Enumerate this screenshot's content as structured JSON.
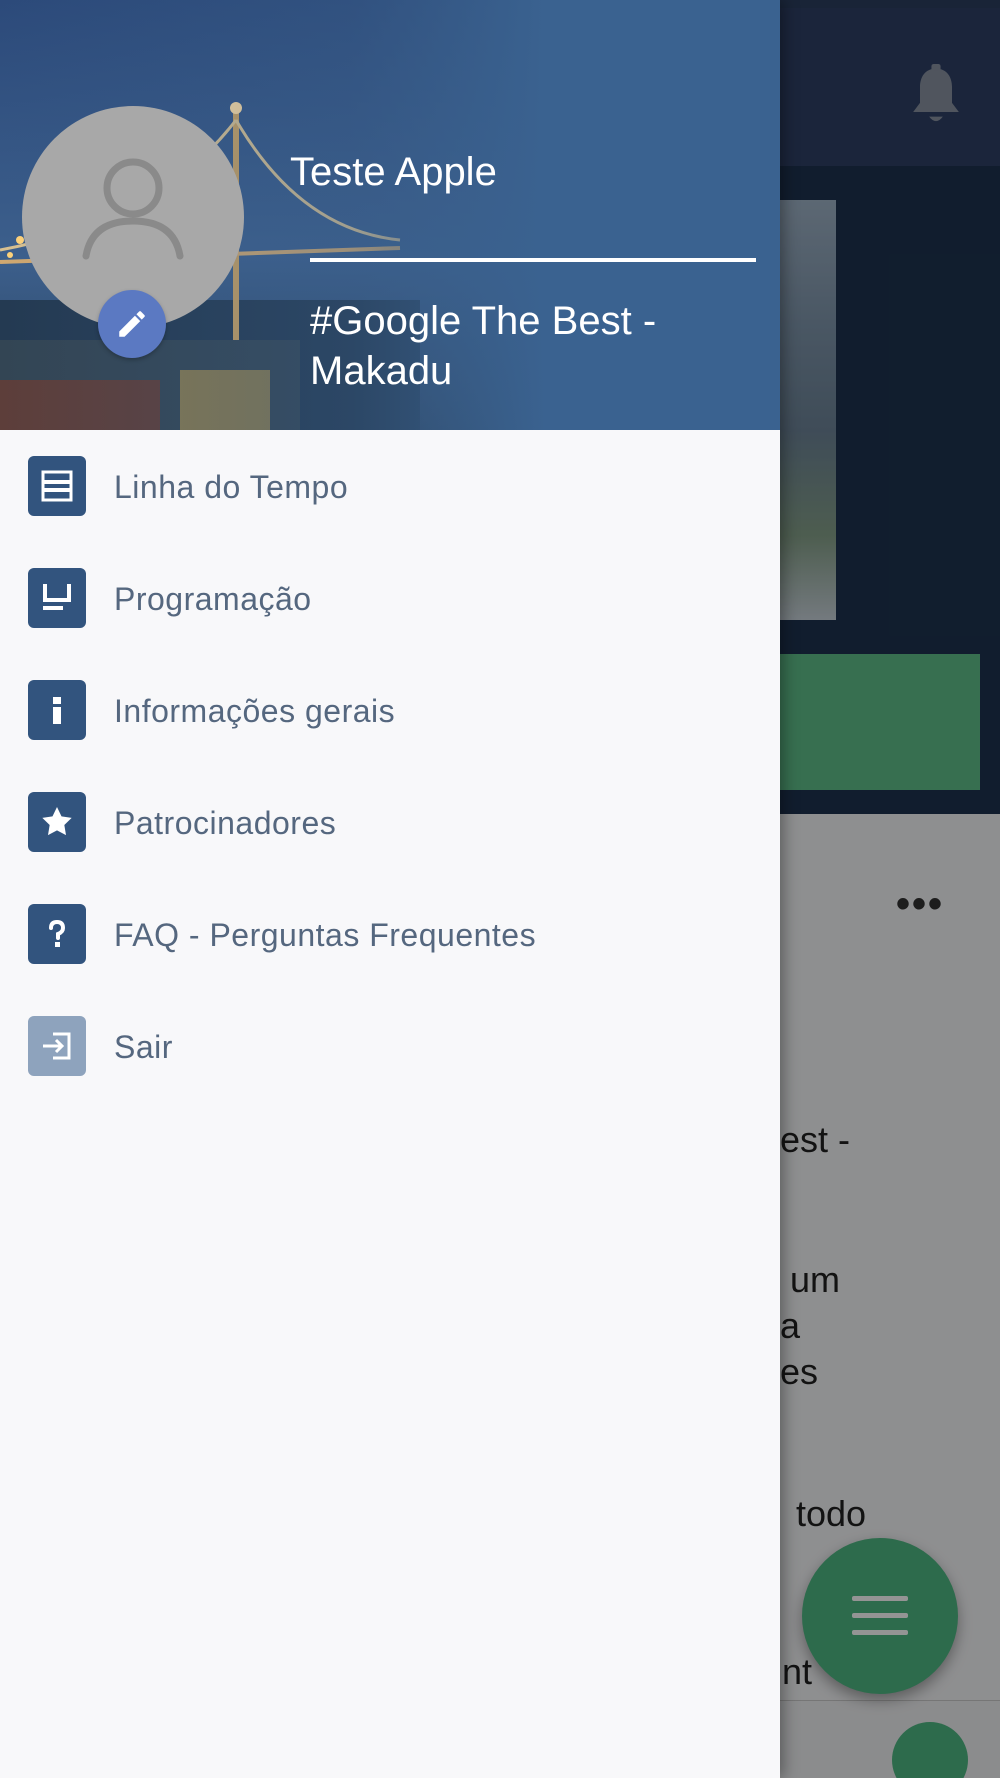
{
  "drawer": {
    "user_name": "Teste Apple",
    "event_name": "#Google The Best - Makadu",
    "menu_items": [
      {
        "label": "Linha do Tempo",
        "icon": "timeline-icon"
      },
      {
        "label": "Programação",
        "icon": "schedule-icon"
      },
      {
        "label": "Informações gerais",
        "icon": "info-icon"
      },
      {
        "label": "Patrocinadores",
        "icon": "star-icon"
      },
      {
        "label": "FAQ - Perguntas Frequentes",
        "icon": "question-icon"
      },
      {
        "label": "Sair",
        "icon": "logout-icon"
      }
    ]
  },
  "background": {
    "text_fragments": [
      "est -",
      "um",
      "a",
      "es",
      "todo",
      "nt"
    ]
  },
  "colors": {
    "primary": "#32547e",
    "menu_text": "#55677f",
    "edit_button": "#5b79c2",
    "accent_green": "#4fb883",
    "drawer_bg": "#f8f8fa"
  }
}
